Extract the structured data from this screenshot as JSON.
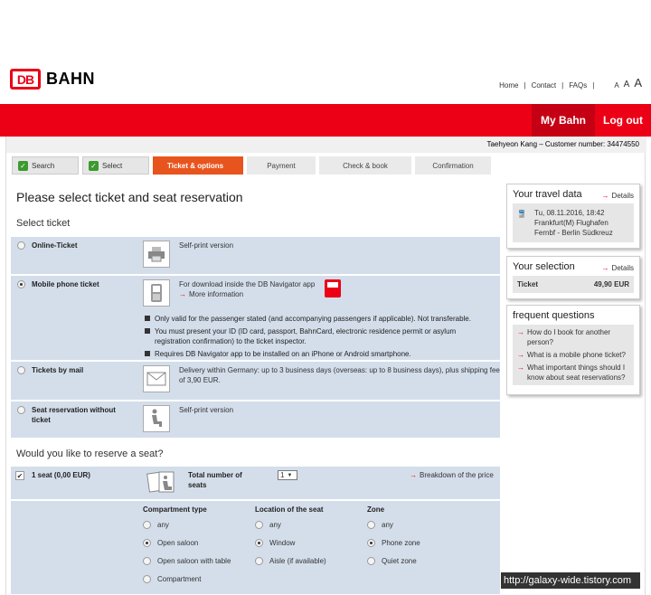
{
  "brand": {
    "logo_text": "DB",
    "name": "BAHN"
  },
  "toplinks": {
    "home": "Home",
    "contact": "Contact",
    "faqs": "FAQs",
    "a_small": "A",
    "a_mid": "A",
    "a_large": "A"
  },
  "nav": {
    "mybahn": "My Bahn",
    "logout": "Log out"
  },
  "customer": "Taehyeon Kang – Customer number: 34474550",
  "steps": [
    {
      "label": "Search"
    },
    {
      "label": "Select"
    },
    {
      "label": "Ticket & options"
    },
    {
      "label": "Payment"
    },
    {
      "label": "Check & book"
    },
    {
      "label": "Confirmation"
    }
  ],
  "page_title": "Please select ticket and seat reservation",
  "select_ticket": "Select ticket",
  "tickets": {
    "online": {
      "label": "Online-Ticket",
      "desc": "Self-print version"
    },
    "mobile": {
      "label": "Mobile phone ticket",
      "desc": "For download inside the DB Navigator app",
      "more": "More information",
      "notes": [
        "Only valid for the passenger stated (and accompanying passengers if applicable). Not transferable.",
        "You must present your ID (ID card, passport, BahnCard, electronic residence permit or asylum registration confirmation) to the ticket inspector.",
        "Requires DB Navigator app to be installed on an iPhone or Android smartphone."
      ]
    },
    "mail": {
      "label": "Tickets by mail",
      "desc": "Delivery within Germany: up to 3 business days (overseas: up to 8 business days), plus shipping fee of 3,90 EUR."
    },
    "seatonly": {
      "label": "Seat reservation without ticket",
      "desc": "Self-print version"
    }
  },
  "reserve_question": "Would you like to reserve a seat?",
  "seat": {
    "label": "1 seat (0,00 EUR)",
    "total_label": "Total number of seats",
    "total_value": "1",
    "breakdown": "Breakdown of the price",
    "compartment": {
      "head": "Compartment type",
      "options": [
        "any",
        "Open saloon",
        "Open saloon with table",
        "Compartment"
      ]
    },
    "location": {
      "head": "Location of the seat",
      "options": [
        "any",
        "Window",
        "Aisle (if available)"
      ]
    },
    "zone": {
      "head": "Zone",
      "options": [
        "any",
        "Phone zone",
        "Quiet zone"
      ]
    }
  },
  "travel": {
    "title": "Your travel data",
    "details": "Details",
    "date": "Tu, 08.11.2016, 18:42",
    "from": "Frankfurt(M) Flughafen",
    "to": "Fernbf - Berlin Südkreuz"
  },
  "selection": {
    "title": "Your selection",
    "details": "Details",
    "ticket_label": "Ticket",
    "ticket_price": "49,90 EUR"
  },
  "faq": {
    "title": "frequent questions",
    "items": [
      "How do I book for another person?",
      "What is a mobile phone ticket?",
      "What important things should I know about seat reservations?"
    ]
  },
  "watermark": "http://galaxy-wide.tistory.com"
}
